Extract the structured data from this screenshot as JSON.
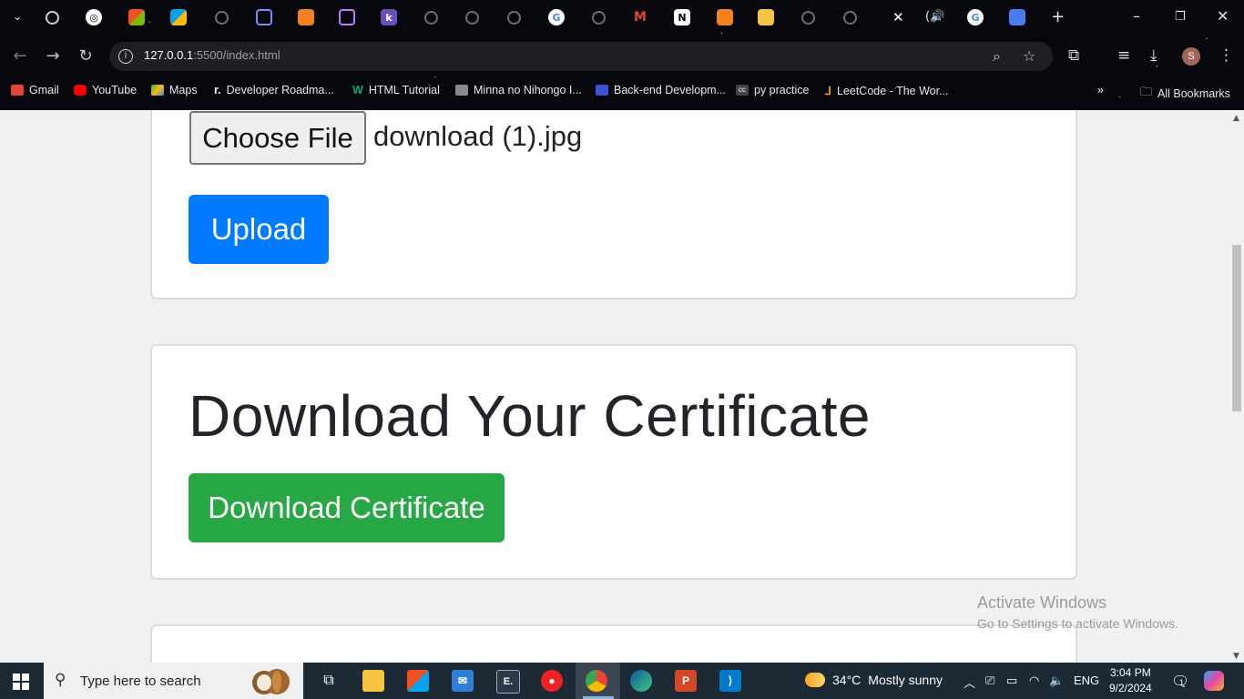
{
  "browser": {
    "tab_count_visible": 21,
    "url_host": "127.0.0.1",
    "url_rest": ":5500/index.html",
    "profile_initial": "S",
    "bookmarks": [
      {
        "label": "Gmail",
        "color": "#ea4335"
      },
      {
        "label": "YouTube",
        "color": "#ff0000"
      },
      {
        "label": "Maps",
        "color": "#34a853"
      },
      {
        "label": "Developer Roadma...",
        "color": "#ffffff"
      },
      {
        "label": "HTML Tutorial",
        "color": "#04aa6d"
      },
      {
        "label": "Minna no Nihongo I...",
        "color": "#8a8a8a"
      },
      {
        "label": "Back-end Developm...",
        "color": "#3b4fd8"
      },
      {
        "label": "py practice",
        "color": "#444444"
      },
      {
        "label": "LeetCode - The Wor...",
        "color": "#ffa116"
      }
    ],
    "all_bookmarks_label": "All Bookmarks"
  },
  "page": {
    "file_input": {
      "button_label": "Choose File",
      "file_name": "download (1).jpg"
    },
    "upload_label": "Upload",
    "download_section": {
      "title": "Download Your Certificate",
      "button_label": "Download Certificate"
    },
    "colors": {
      "upload": "#007bff",
      "download": "#28a745",
      "title": "#212529"
    }
  },
  "watermark": {
    "line1": "Activate Windows",
    "line2": "Go to Settings to activate Windows."
  },
  "taskbar": {
    "search_placeholder": "Type here to search",
    "weather_temp": "34°C",
    "weather_desc": "Mostly sunny",
    "language": "ENG",
    "time": "3:04 PM",
    "date": "9/2/2024",
    "notification_count": "1"
  }
}
